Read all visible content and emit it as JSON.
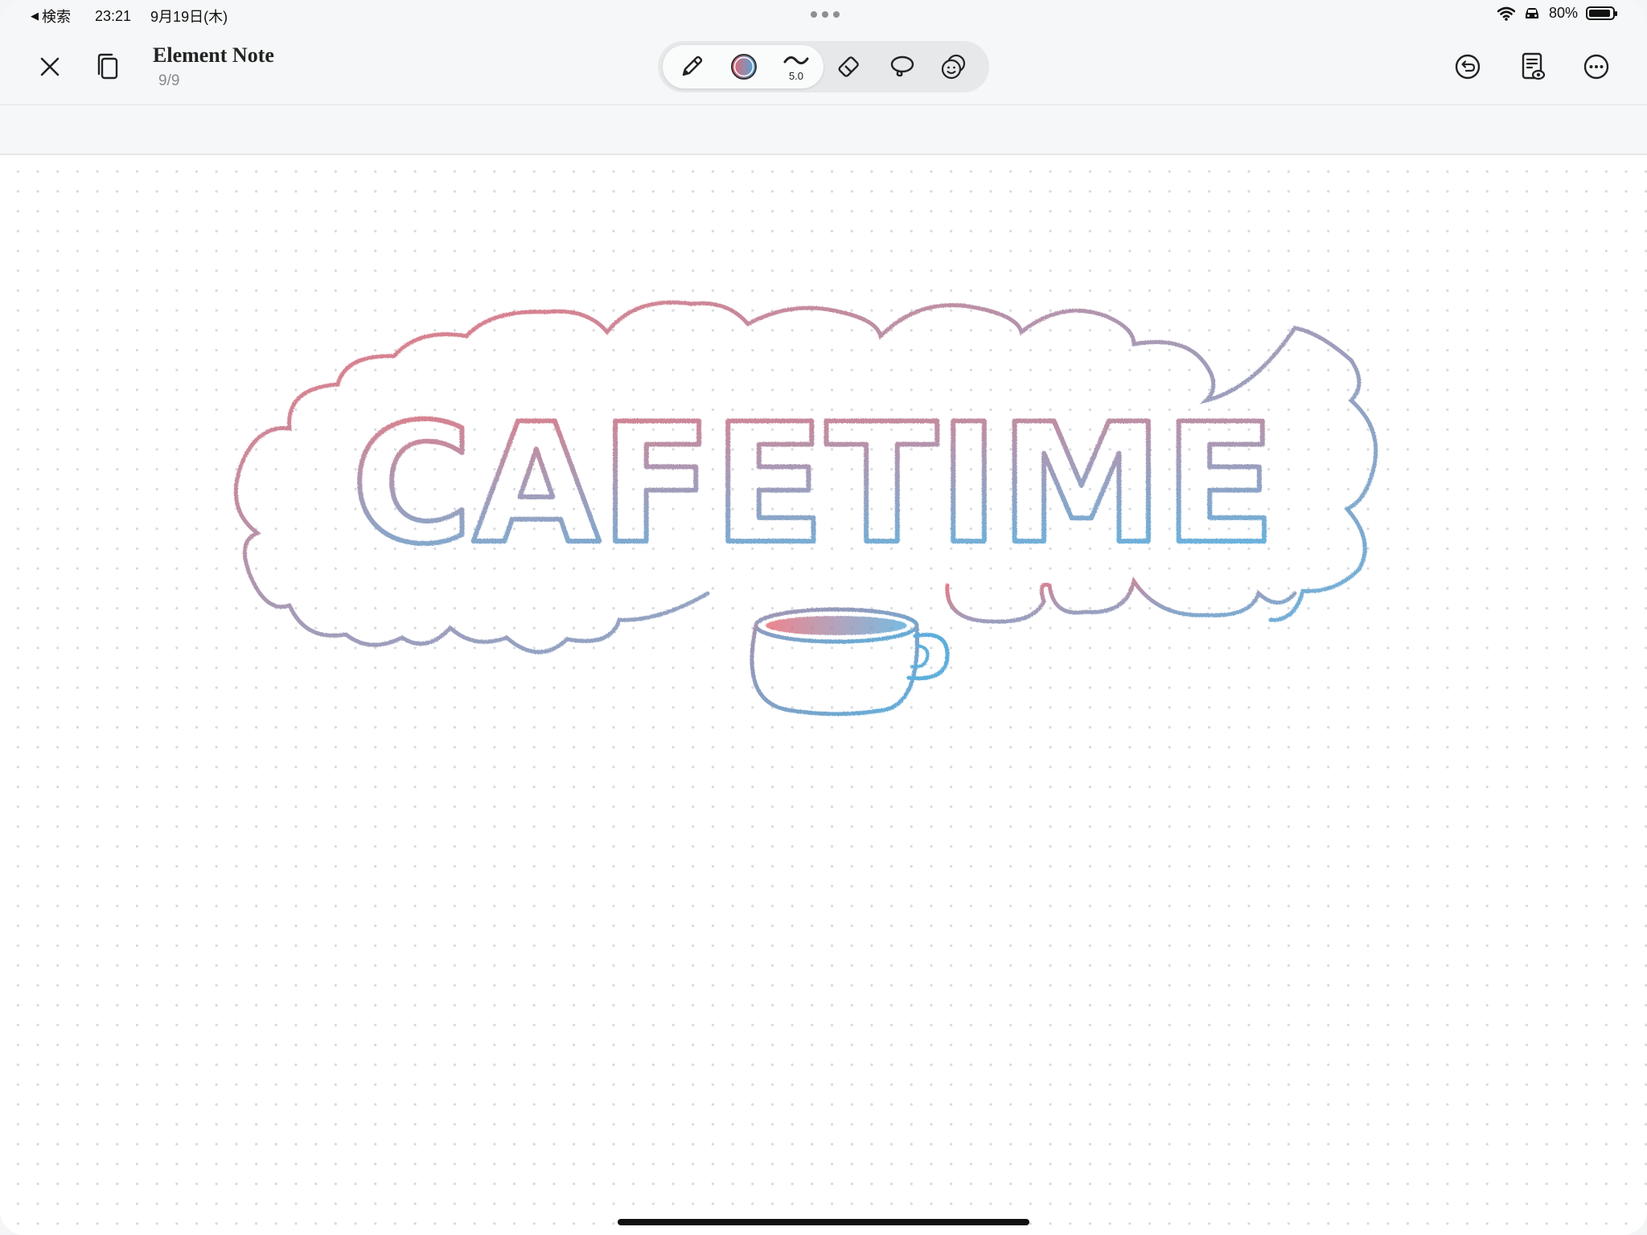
{
  "status_bar": {
    "back_label": "検索",
    "time": "23:21",
    "date": "9月19日(木)",
    "battery": "80%",
    "battery_level": 0.8
  },
  "toolbar": {
    "title": "Element Note",
    "page_count": "9/9",
    "stroke_width": "5.0"
  },
  "drawing": {
    "word": "CAFETIME",
    "colors": {
      "red": "#e8606a",
      "purple": "#9b88a8",
      "blue": "#4ea6d8"
    }
  },
  "icons": {
    "close": "close-icon",
    "pages": "pages-icon",
    "pen": "pen-icon",
    "color": "color-swatch-icon",
    "width": "stroke-width-icon",
    "eraser": "eraser-icon",
    "lasso": "lasso-icon",
    "sticker": "sticker-icon",
    "undo": "undo-icon",
    "preview": "document-preview-icon",
    "more": "more-icon"
  }
}
